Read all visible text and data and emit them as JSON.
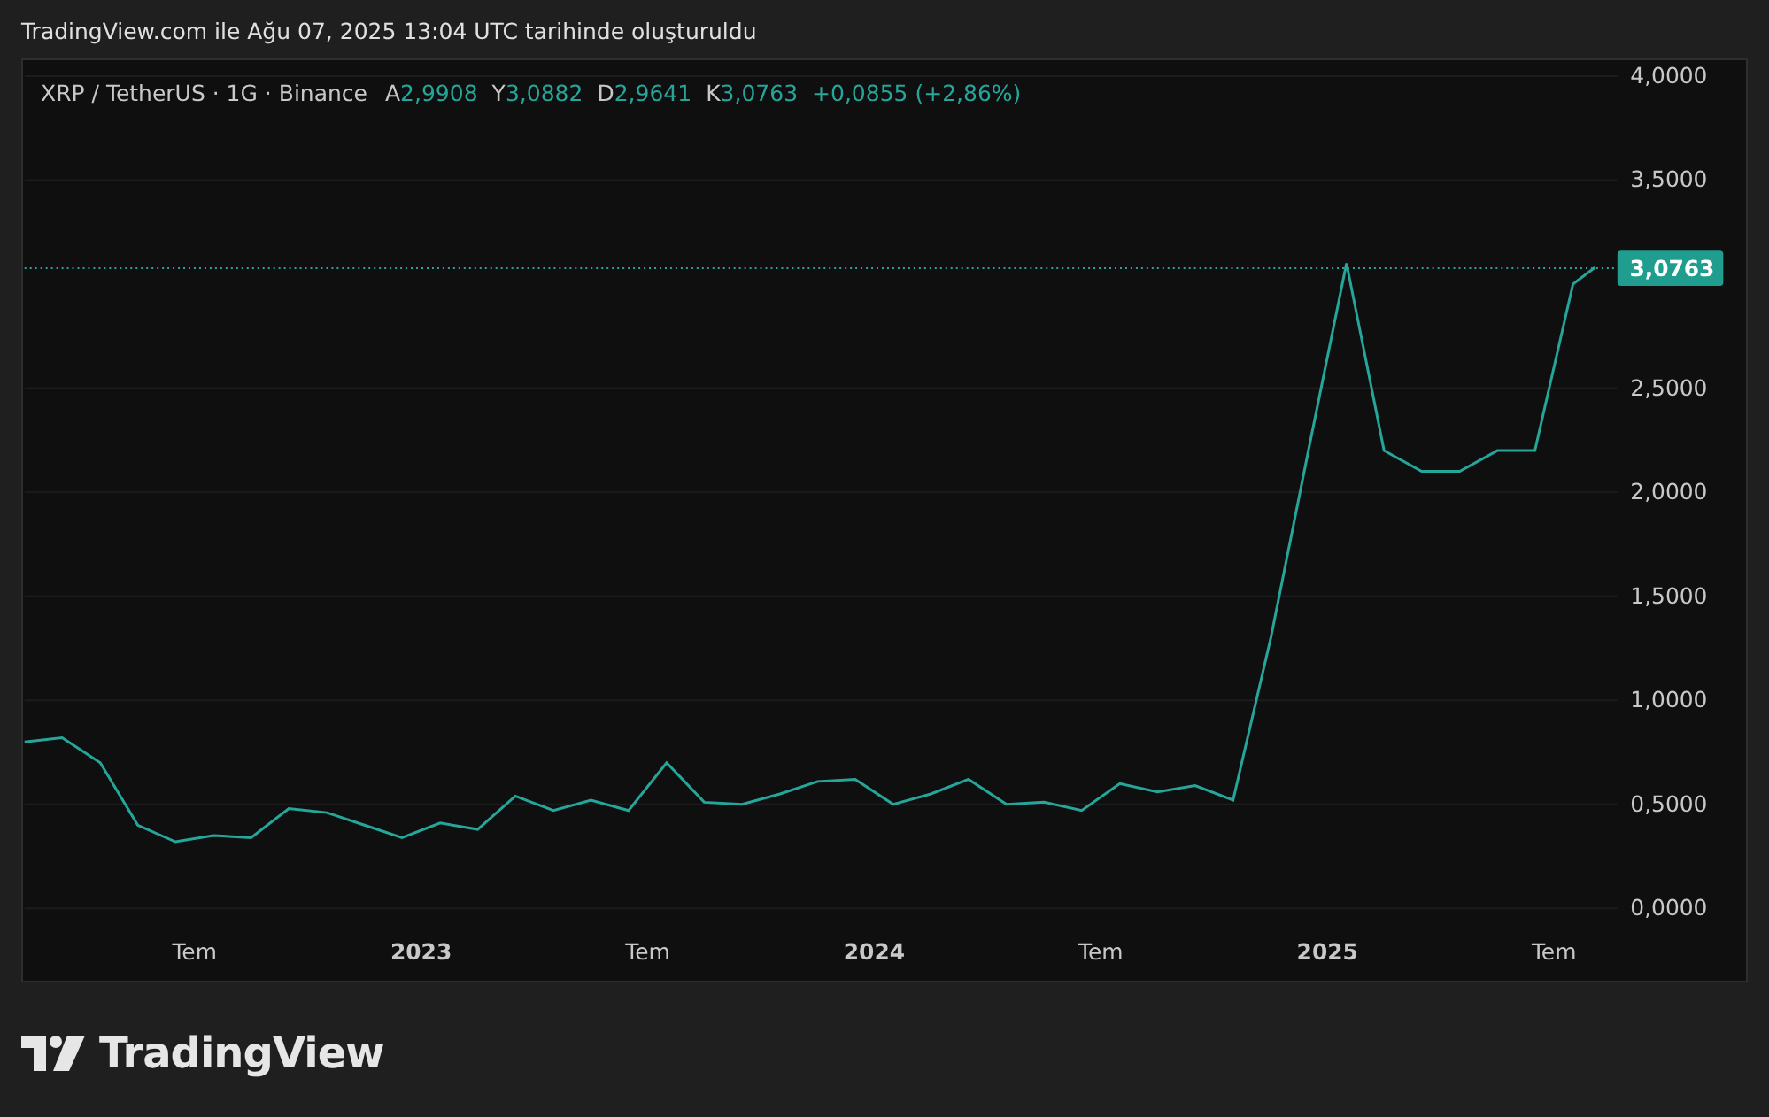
{
  "header": {
    "title": "TradingView.com ile Ağu 07, 2025 13:04 UTC tarihinde oluşturuldu"
  },
  "legend": {
    "symbol": "XRP / TetherUS · 1G · Binance",
    "ohlc": [
      {
        "label": "A",
        "value": "2,9908"
      },
      {
        "label": "Y",
        "value": "3,0882"
      },
      {
        "label": "D",
        "value": "2,9641"
      },
      {
        "label": "K",
        "value": "3,0763"
      }
    ],
    "change": "+0,0855 (+2,86%)"
  },
  "chart": {
    "chart_data": {
      "type": "line",
      "grid": true,
      "ref_lines": [
        {
          "axis": "y",
          "value": 3.0763,
          "label": "3,0763"
        }
      ],
      "x": [
        2022.125,
        2022.208,
        2022.292,
        2022.375,
        2022.458,
        2022.542,
        2022.625,
        2022.708,
        2022.792,
        2022.875,
        2022.958,
        2023.042,
        2023.125,
        2023.208,
        2023.292,
        2023.375,
        2023.458,
        2023.542,
        2023.625,
        2023.708,
        2023.792,
        2023.875,
        2023.958,
        2024.042,
        2024.125,
        2024.208,
        2024.292,
        2024.375,
        2024.458,
        2024.542,
        2024.625,
        2024.708,
        2024.792,
        2024.875,
        2024.958,
        2025.042,
        2025.125,
        2025.208,
        2025.292,
        2025.375,
        2025.458,
        2025.542,
        2025.59
      ],
      "series": [
        {
          "color": "#26a69a",
          "values": [
            0.8,
            0.82,
            0.7,
            0.4,
            0.32,
            0.35,
            0.34,
            0.48,
            0.46,
            0.4,
            0.34,
            0.41,
            0.38,
            0.54,
            0.47,
            0.52,
            0.47,
            0.7,
            0.51,
            0.5,
            0.55,
            0.61,
            0.62,
            0.5,
            0.55,
            0.62,
            0.5,
            0.51,
            0.47,
            0.6,
            0.56,
            0.59,
            0.52,
            1.3,
            2.2,
            3.1,
            2.2,
            2.1,
            2.1,
            2.2,
            2.2,
            3.0,
            3.08
          ]
        }
      ],
      "xlim": [
        2022.125,
        2025.64
      ],
      "ylim": [
        0,
        4
      ],
      "xticks": [
        {
          "value": 2022.5,
          "label": "Tem"
        },
        {
          "value": 2023,
          "label": "2023"
        },
        {
          "value": 2023.5,
          "label": "Tem"
        },
        {
          "value": 2024,
          "label": "2024"
        },
        {
          "value": 2024.5,
          "label": "Tem"
        },
        {
          "value": 2025,
          "label": "2025"
        },
        {
          "value": 2025.5,
          "label": "Tem"
        }
      ],
      "yticks": [
        {
          "value": 0,
          "label": "0,0000"
        },
        {
          "value": 0.5,
          "label": "0,5000"
        },
        {
          "value": 1,
          "label": "1,0000"
        },
        {
          "value": 1.5,
          "label": "1,5000"
        },
        {
          "value": 2,
          "label": "2,0000"
        },
        {
          "value": 2.5,
          "label": "2,5000"
        },
        {
          "value": 3.5,
          "label": "3,5000"
        },
        {
          "value": 4,
          "label": "4,0000"
        }
      ]
    }
  },
  "brand": {
    "name": "TradingView"
  }
}
